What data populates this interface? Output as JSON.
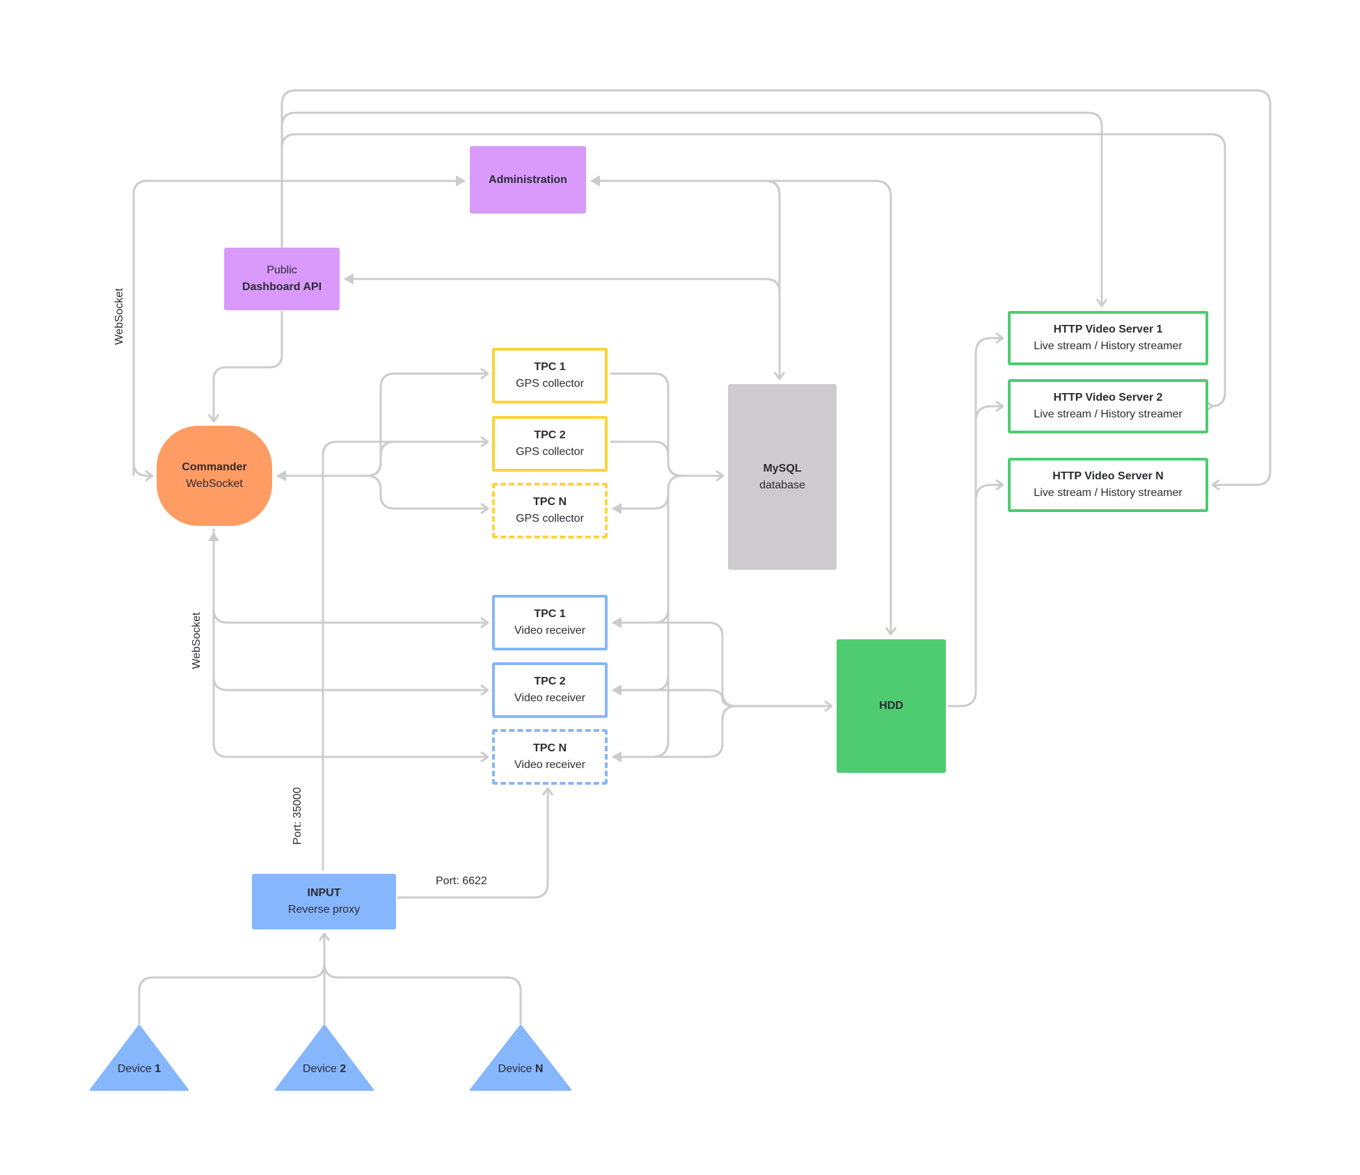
{
  "colors": {
    "purple": "#d99afc",
    "orange": "#ff9c63",
    "yellow": "#fdd339",
    "gray": "#cdcbcd",
    "blue": "#86b6fb",
    "green": "#4fcb71",
    "wire": "#cccccc",
    "text": "#2b2b33"
  },
  "nodes": {
    "administration": {
      "title": "Administration"
    },
    "public_api": {
      "line1": "Public",
      "title": "Dashboard API"
    },
    "commander": {
      "title": "Commander",
      "subtitle": "WebSocket"
    },
    "gps": [
      {
        "title": "TPC 1",
        "subtitle": "GPS collector"
      },
      {
        "title": "TPC 2",
        "subtitle": "GPS collector"
      },
      {
        "title": "TPC N",
        "subtitle": "GPS collector"
      }
    ],
    "mysql": {
      "title": "MySQL",
      "subtitle": "database"
    },
    "video": [
      {
        "title": "TPC 1",
        "subtitle": "Video receiver"
      },
      {
        "title": "TPC 2",
        "subtitle": "Video receiver"
      },
      {
        "title": "TPC N",
        "subtitle": "Video receiver"
      }
    ],
    "hdd": {
      "title": "HDD"
    },
    "http": [
      {
        "title": "HTTP Video Server 1",
        "subtitle": "Live stream / History streamer"
      },
      {
        "title": "HTTP Video Server 2",
        "subtitle": "Live stream / History streamer"
      },
      {
        "title": "HTTP Video Server N",
        "subtitle": "Live stream / History streamer"
      }
    ],
    "input": {
      "title": "INPUT",
      "subtitle": "Reverse proxy"
    },
    "devices": [
      {
        "prefix": "Device ",
        "id": "1"
      },
      {
        "prefix": "Device ",
        "id": "2"
      },
      {
        "prefix": "Device ",
        "id": "N"
      }
    ]
  },
  "labels": {
    "websocket_top": "WebSocket",
    "websocket_bottom": "WebSocket",
    "port_35000": "Port: 35000",
    "port_6622": "Port: 6622"
  }
}
